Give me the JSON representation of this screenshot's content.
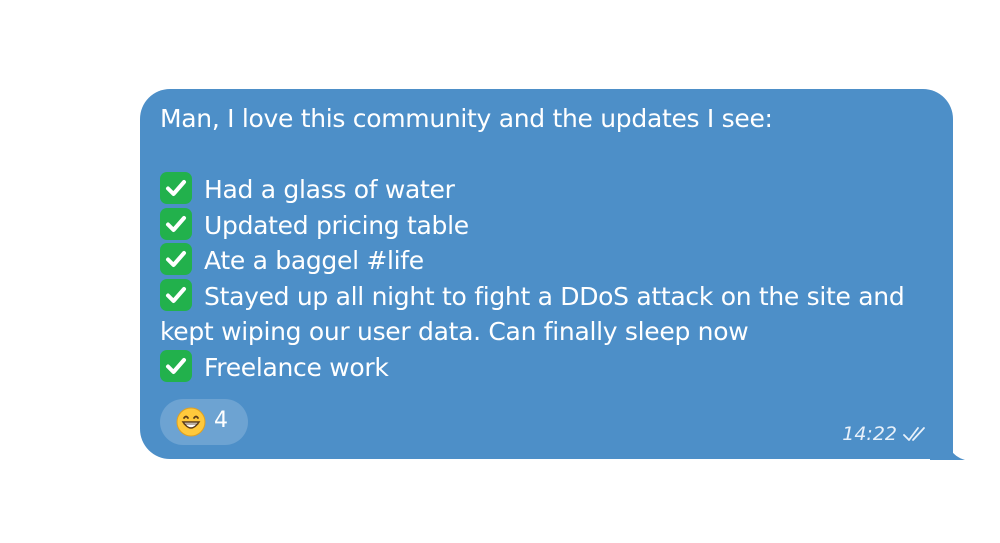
{
  "message": {
    "intro": "Man, I love this community and the updates I see:",
    "items": [
      {
        "icon": "white-check-mark-emoji",
        "text": "Had a glass of water"
      },
      {
        "icon": "white-check-mark-emoji",
        "text": "Updated pricing table"
      },
      {
        "icon": "white-check-mark-emoji",
        "text": "Ate a baggel #life"
      },
      {
        "icon": "white-check-mark-emoji",
        "text": "Stayed up all night to fight a DDoS attack on the site and",
        "continuation": "kept wiping our user data. Can finally sleep now"
      },
      {
        "icon": "white-check-mark-emoji",
        "text": "Freelance work"
      }
    ],
    "reaction": {
      "emoji": "grinning-face-with-smiling-eyes",
      "count": "4"
    },
    "time": "14:22",
    "status_icon": "double-check-read-icon"
  },
  "colors": {
    "bubble": "#4d8fc8",
    "check_box": "#22b14c",
    "text": "#ffffff"
  }
}
